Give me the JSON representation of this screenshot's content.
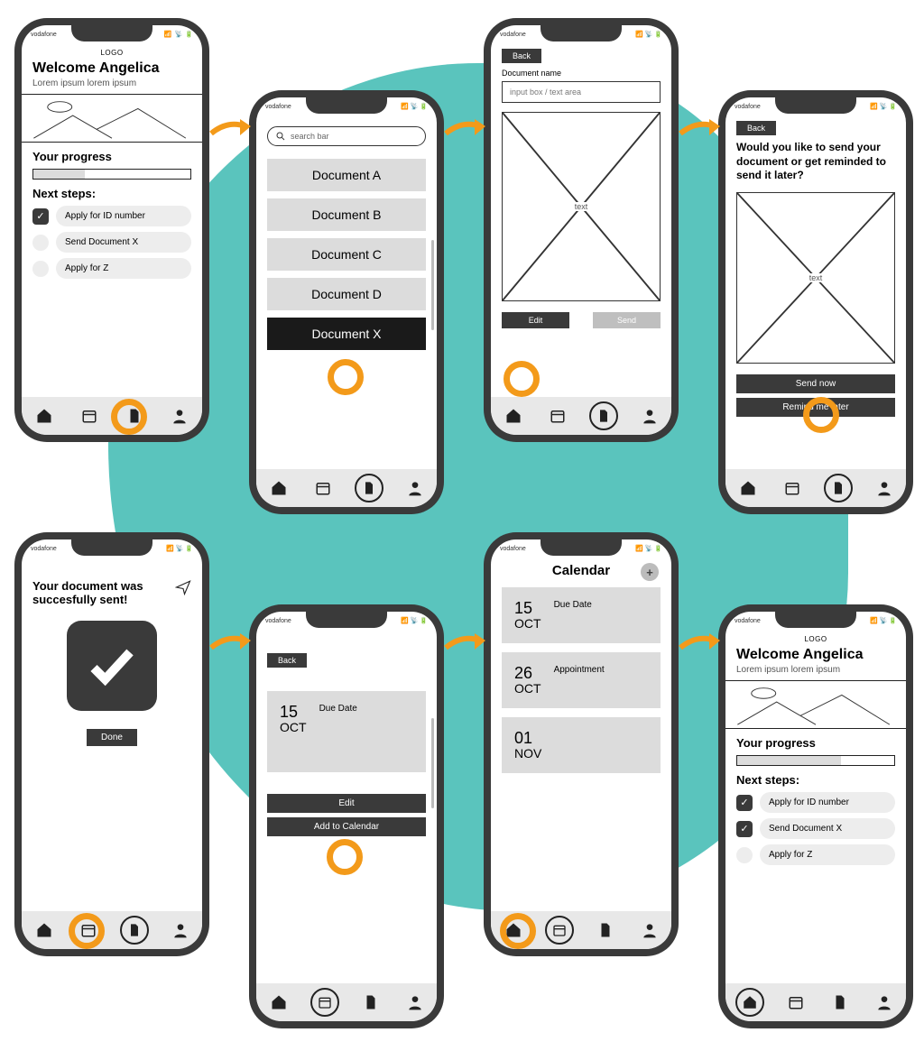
{
  "status": {
    "carrier": "vodafone"
  },
  "highlight_color": "#f39a1a",
  "screens": {
    "home": {
      "logo": "LOGO",
      "welcome": "Welcome Angelica",
      "subtitle": "Lorem ipsum lorem ipsum",
      "progress_heading": "Your progress",
      "next_heading": "Next steps:",
      "steps": [
        {
          "label": "Apply for ID number",
          "done": true
        },
        {
          "label": "Send Document X",
          "done": false
        },
        {
          "label": "Apply for Z",
          "done": false
        }
      ]
    },
    "docs": {
      "search_placeholder": "search bar",
      "items": [
        {
          "label": "Document A"
        },
        {
          "label": "Document B"
        },
        {
          "label": "Document C"
        },
        {
          "label": "Document D"
        },
        {
          "label": "Document X",
          "active": true
        }
      ]
    },
    "doc_detail": {
      "back": "Back",
      "name_label": "Document name",
      "input_placeholder": "input box / text area",
      "placeholder_text": "text",
      "edit": "Edit",
      "send": "Send"
    },
    "confirm": {
      "back": "Back",
      "question": "Would you like to send your document or get reminded to send it later?",
      "placeholder_text": "text",
      "send_now": "Send now",
      "remind_later": "Remind me later"
    },
    "success": {
      "title": "Your document was succesfully sent!",
      "done": "Done"
    },
    "due": {
      "back": "Back",
      "day": "15",
      "month": "OCT",
      "label": "Due Date",
      "edit": "Edit",
      "add": "Add to Calendar"
    },
    "calendar": {
      "title": "Calendar",
      "items": [
        {
          "day": "15",
          "month": "OCT",
          "label": "Due Date"
        },
        {
          "day": "26",
          "month": "OCT",
          "label": "Appointment"
        },
        {
          "day": "01",
          "month": "NOV",
          "label": ""
        }
      ]
    },
    "home2": {
      "logo": "LOGO",
      "welcome": "Welcome Angelica",
      "subtitle": "Lorem ipsum lorem ipsum",
      "progress_heading": "Your progress",
      "next_heading": "Next steps:",
      "steps": [
        {
          "label": "Apply for ID number",
          "done": true
        },
        {
          "label": "Send Document X",
          "done": true
        },
        {
          "label": "Apply for Z",
          "done": false
        }
      ]
    }
  }
}
